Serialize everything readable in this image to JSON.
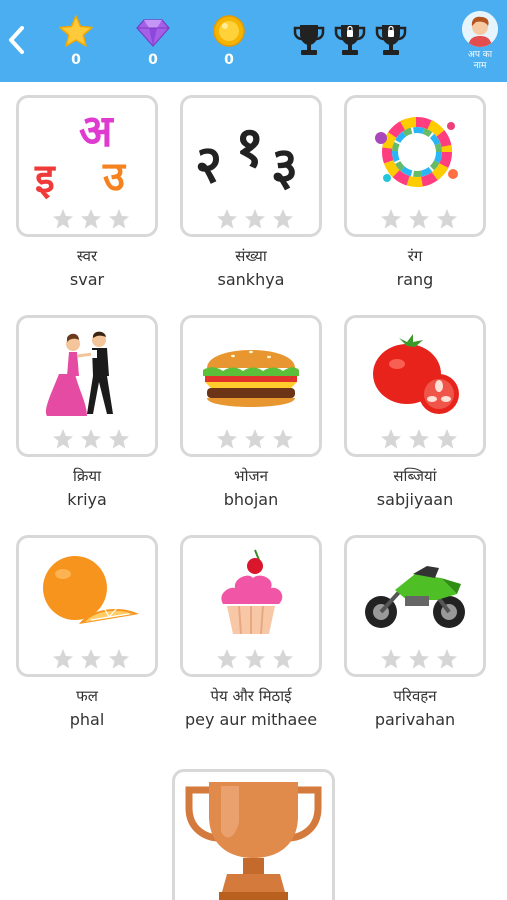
{
  "header": {
    "stars": "0",
    "gems": "0",
    "coins": "0",
    "avatar_label": "अप का\nनाम"
  },
  "categories": [
    {
      "hindi": "स्वर",
      "latin": "svar",
      "icon": "hindi-letters-icon",
      "rating": 0
    },
    {
      "hindi": "संख्या",
      "latin": "sankhya",
      "icon": "hindi-numbers-icon",
      "rating": 0
    },
    {
      "hindi": "रंग",
      "latin": "rang",
      "icon": "color-splash-icon",
      "rating": 0
    },
    {
      "hindi": "क्रिया",
      "latin": "kriya",
      "icon": "dancing-couple-icon",
      "rating": 0
    },
    {
      "hindi": "भोजन",
      "latin": "bhojan",
      "icon": "burger-icon",
      "rating": 0
    },
    {
      "hindi": "सब्जियां",
      "latin": "sabjiyaan",
      "icon": "tomato-icon",
      "rating": 0
    },
    {
      "hindi": "फल",
      "latin": "phal",
      "icon": "orange-icon",
      "rating": 0
    },
    {
      "hindi": "पेय और मिठाई",
      "latin": "pey aur mithaee",
      "icon": "cupcake-icon",
      "rating": 0
    },
    {
      "hindi": "परिवहन",
      "latin": "parivahan",
      "icon": "motorcycle-icon",
      "rating": 0
    }
  ],
  "colors": {
    "header_bg": "#4aaef0",
    "card_border": "#d8d8d8",
    "star_empty": "#d6d6d6"
  }
}
